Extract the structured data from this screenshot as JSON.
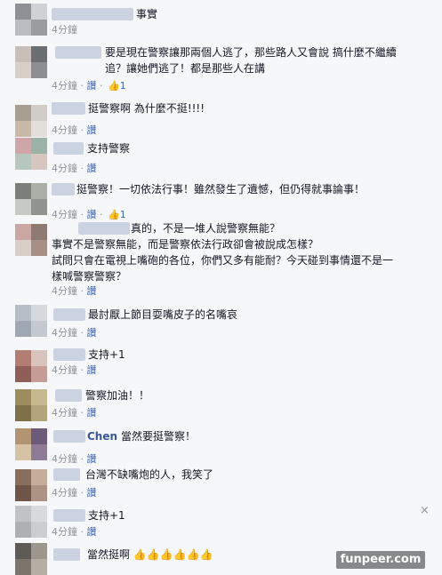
{
  "comments": [
    {
      "text": "事實",
      "meta": "4分鐘",
      "av": [
        "#8d9094",
        "#cfd1d4",
        "#b9bcc0",
        "#9a9ca0"
      ]
    },
    {
      "text": "要是現在警察讓那兩個人逃了，那些路人又會說 搞什麼不繼續\n追？讓她們逃了！都是那些人在講",
      "meta": "4分鐘",
      "reply": "讚",
      "likes": "1",
      "av": [
        "#c9bfb8",
        "#6a6e73",
        "#d8d0c8",
        "#8b8f94"
      ]
    },
    {
      "text": "挺警察啊 為什麼不挺!!!!",
      "meta": "4分鐘",
      "reply": "讚",
      "av": [
        "#a99e92",
        "#d0ccc8",
        "#c8b8a8",
        "#e2ded9"
      ]
    },
    {
      "text": "支持警察",
      "meta": "4分鐘",
      "reply": "讚",
      "av": [
        "#cfa6a8",
        "#9db2a6",
        "#b8c7bd",
        "#d7c5c0"
      ]
    },
    {
      "text": "挺警察！一切依法行事！雖然發生了遺憾，但仍得就事論事！",
      "meta": "4分鐘",
      "reply": "讚",
      "likes": "1",
      "av": [
        "#7b7f7a",
        "#aab0a8",
        "#c6c9c4",
        "#8f948e"
      ]
    },
    {
      "text": "真的，不是一堆人說警察無能？\n事實不是警察無能，而是警察依法行政卻會被說成怎樣？\n試問只會在電視上嘴砲的各位，你們又多有能耐？今天碰到事情還不是一\n樣喊警察警察？",
      "meta": "4分鐘",
      "reply": "讚",
      "av": [
        "#caa7a2",
        "#8e7a70",
        "#d9cfc8",
        "#a68f85"
      ]
    },
    {
      "text": "最討厭上節目耍嘴皮子的名嘴哀",
      "meta": "4分鐘",
      "reply": "讚",
      "av": [
        "#b8bec7",
        "#d5d8dd",
        "#9fa7b2",
        "#c4c9d0"
      ]
    },
    {
      "text": "支持+1",
      "meta": "4分鐘",
      "reply": "讚",
      "av": [
        "#b27d73",
        "#d9c3bd",
        "#8f5f57",
        "#c69d94"
      ]
    },
    {
      "text": "警察加油！！",
      "meta": "4分鐘",
      "reply": "讚",
      "av": [
        "#9c8c5e",
        "#c7b98f",
        "#7e7148",
        "#b3a57b"
      ]
    },
    {
      "name": "Chen",
      "text": "當然要挺警察！",
      "meta": "4分鐘",
      "reply": "讚",
      "av": [
        "#b39472",
        "#6b5a78",
        "#d6c3a5",
        "#8e7b95"
      ]
    },
    {
      "text": "台灣不缺嘴炮的人，我笑了",
      "meta": "4分鐘",
      "reply": "讚",
      "av": [
        "#8a6e5d",
        "#c5ad9c",
        "#6e5547",
        "#ad9383"
      ]
    },
    {
      "text": "支持+1",
      "meta": "4分鐘",
      "reply": "讚",
      "av": [
        "#c0c2c4",
        "#d8dadc",
        "#aeb1b4",
        "#cbcdcf"
      ]
    },
    {
      "text": "當然挺啊 👍👍👍👍👍👍",
      "av": [
        "#5e5a55",
        "#9d968c",
        "#7b756c",
        "#b5aea4"
      ]
    }
  ],
  "close_icon": "×",
  "watermark": "funpeer.com"
}
